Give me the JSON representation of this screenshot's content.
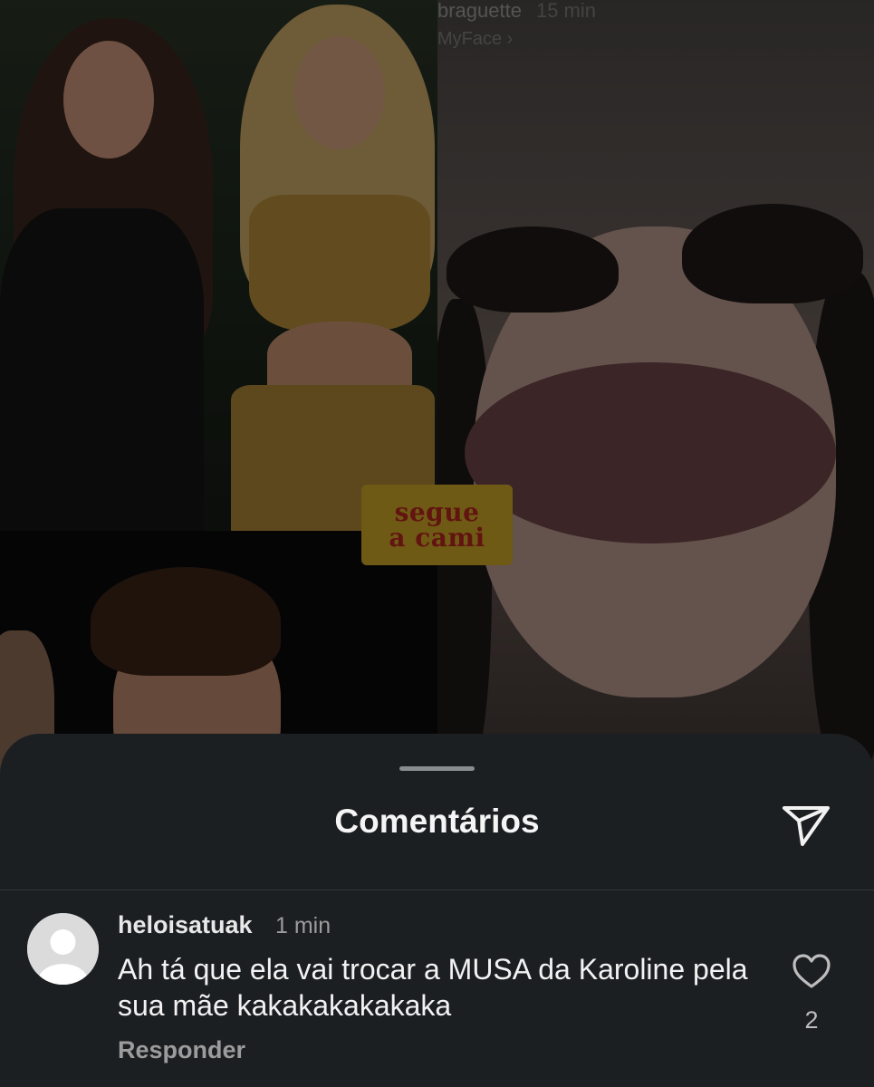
{
  "story": {
    "username": "braguette",
    "time": "15 min",
    "subtitle": "MyFace ›",
    "sticker_line1": "segue",
    "sticker_line2": "a cami"
  },
  "comments_sheet": {
    "title": "Comentários",
    "send_icon": "send-icon",
    "comments": [
      {
        "username": "heloisatuak",
        "time": "1 min",
        "text": "Ah tá que ela vai trocar a MUSA da Karoline pela sua mãe kakakakakakaka",
        "reply_label": "Responder",
        "like_count": "2",
        "like_icon": "heart-icon",
        "avatar_icon": "default-avatar-icon"
      }
    ]
  },
  "colors": {
    "sheet_bg": "#1c1f22",
    "sticker_bg": "#c9a427",
    "sticker_text": "#b3261e"
  }
}
